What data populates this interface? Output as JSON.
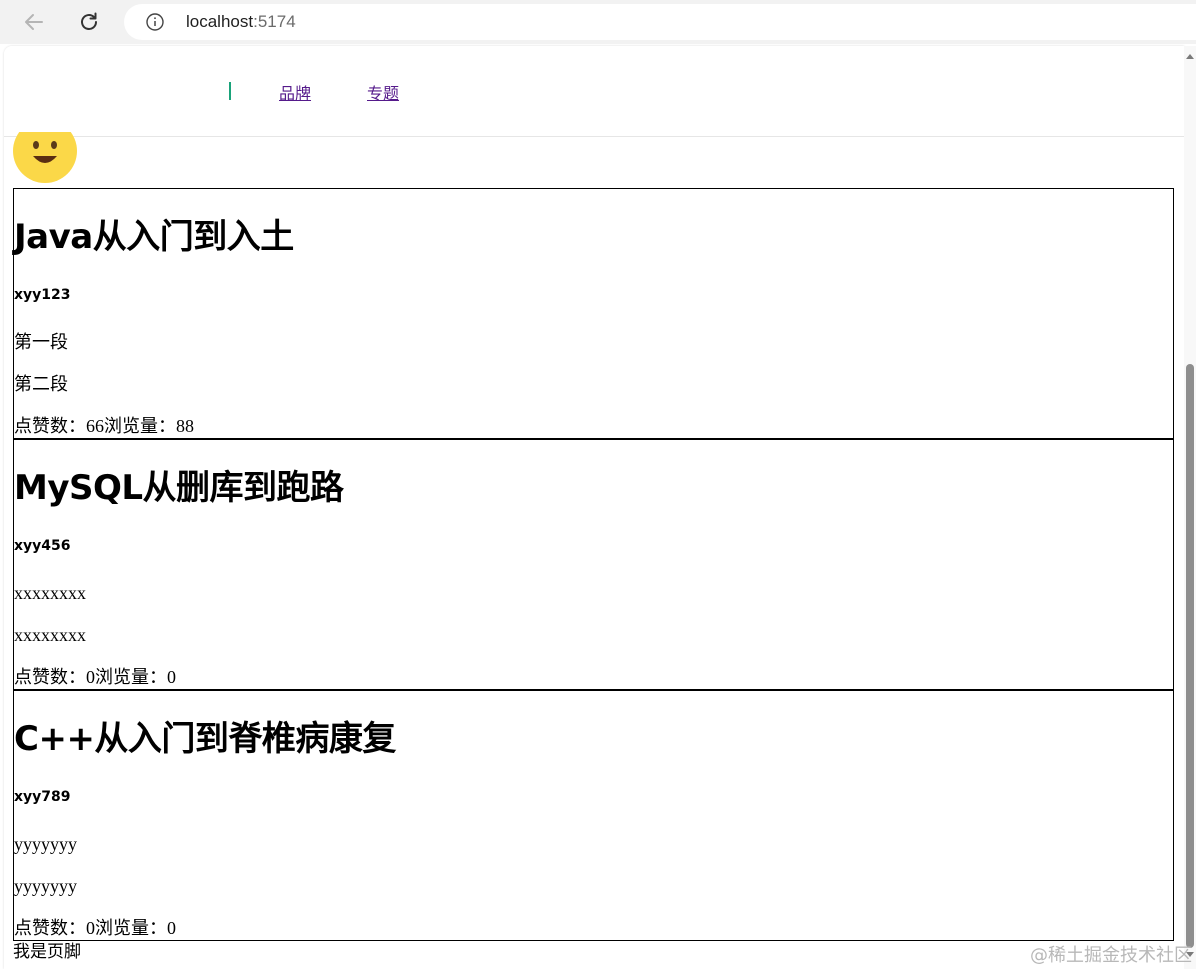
{
  "browser": {
    "url_host": "localhost",
    "url_port": ":5174",
    "back_icon": "arrow-left-icon",
    "reload_icon": "reload-icon",
    "info_icon": "info-icon"
  },
  "header": {
    "nav": [
      {
        "label": "品牌"
      },
      {
        "label": "专题"
      }
    ],
    "accent_color": "#1aa37a",
    "link_color": "#551a8b"
  },
  "avatar": {
    "icon": "smiley-emoji-icon"
  },
  "articles": [
    {
      "title": "Java从入门到入土",
      "author": "xyy123",
      "paragraphs": [
        "第一段",
        "第二段"
      ],
      "likes_label": "点赞数：",
      "likes": "66",
      "views_label": "浏览量：",
      "views": "88"
    },
    {
      "title": "MySQL从删库到跑路",
      "author": "xyy456",
      "paragraphs": [
        "xxxxxxxx",
        "xxxxxxxx"
      ],
      "likes_label": "点赞数：",
      "likes": "0",
      "views_label": "浏览量：",
      "views": "0"
    },
    {
      "title": "C++从入门到脊椎病康复",
      "author": "xyy789",
      "paragraphs": [
        "yyyyyyy",
        "yyyyyyy"
      ],
      "likes_label": "点赞数：",
      "likes": "0",
      "views_label": "浏览量：",
      "views": "0"
    }
  ],
  "footer": {
    "text": "我是页脚"
  },
  "watermark": "@稀土掘金技术社区"
}
